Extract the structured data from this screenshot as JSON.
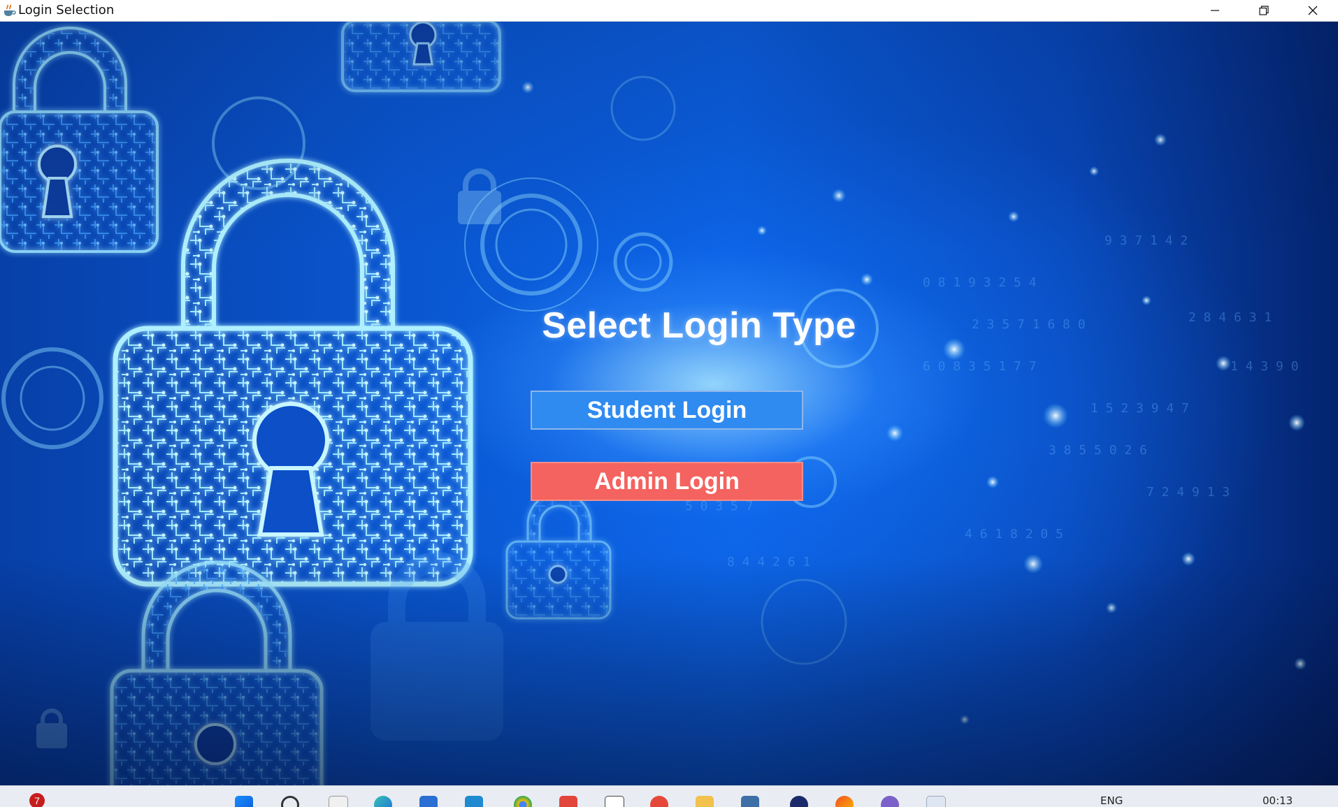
{
  "window": {
    "title": "Login Selection",
    "app_icon": "java-cup-icon"
  },
  "main": {
    "heading": "Select Login Type",
    "student_button_label": "Student Login",
    "admin_button_label": "Admin Login",
    "background": "digital padlock circuit artwork"
  },
  "colors": {
    "student_button": "#2f8bf0",
    "admin_button": "#f4635f",
    "heading_text": "#ffffff",
    "background_primary": "#0b5fe0"
  },
  "taskbar": {
    "notification_count": "7",
    "language": "ENG",
    "clock": "00:13",
    "pinned_icons": [
      "windows-start-icon",
      "search-icon",
      "file-explorer-icon",
      "edge-icon",
      "store-icon",
      "download-icon",
      "chrome-icon",
      "gmail-icon",
      "pen-tool-icon",
      "record-icon",
      "folder-icon",
      "terminal-icon",
      "browser-icon",
      "paint-icon",
      "teams-icon",
      "java-app-icon"
    ]
  }
}
